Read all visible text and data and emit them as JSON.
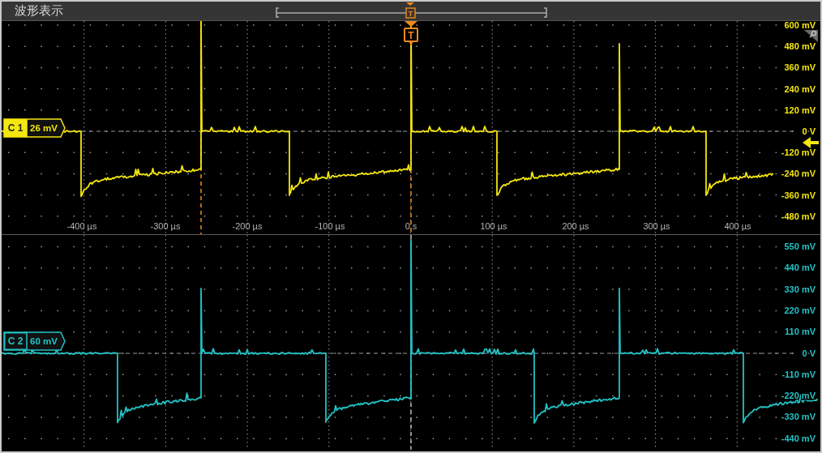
{
  "title": "波形表示",
  "timeline": {
    "trigger_label": "T"
  },
  "trigger_marker": {
    "label": "T"
  },
  "panels": [
    {
      "channel": {
        "name": "C 1",
        "scale": "26 mV"
      },
      "color": "#f4e60f",
      "y_labels": [
        "600 mV",
        "480 mV",
        "360 mV",
        "240 mV",
        "120 mV",
        "0 V",
        "-120 mV",
        "-240 mV",
        "-360 mV",
        "-480 mV"
      ],
      "x_labels": [
        "-400 µs",
        "-300 µs",
        "-200 µs",
        "-100 µs",
        "0 s",
        "100 µs",
        "200 µs",
        "300 µs",
        "400 µs"
      ]
    },
    {
      "channel": {
        "name": "C 2",
        "scale": "60 mV"
      },
      "color": "#22c3c6",
      "y_labels": [
        "550 mV",
        "440 mV",
        "330 mV",
        "220 mV",
        "110 mV",
        "0 V",
        "-110 mV",
        "-220 mV",
        "-330 mV",
        "-440 mV"
      ]
    }
  ]
}
